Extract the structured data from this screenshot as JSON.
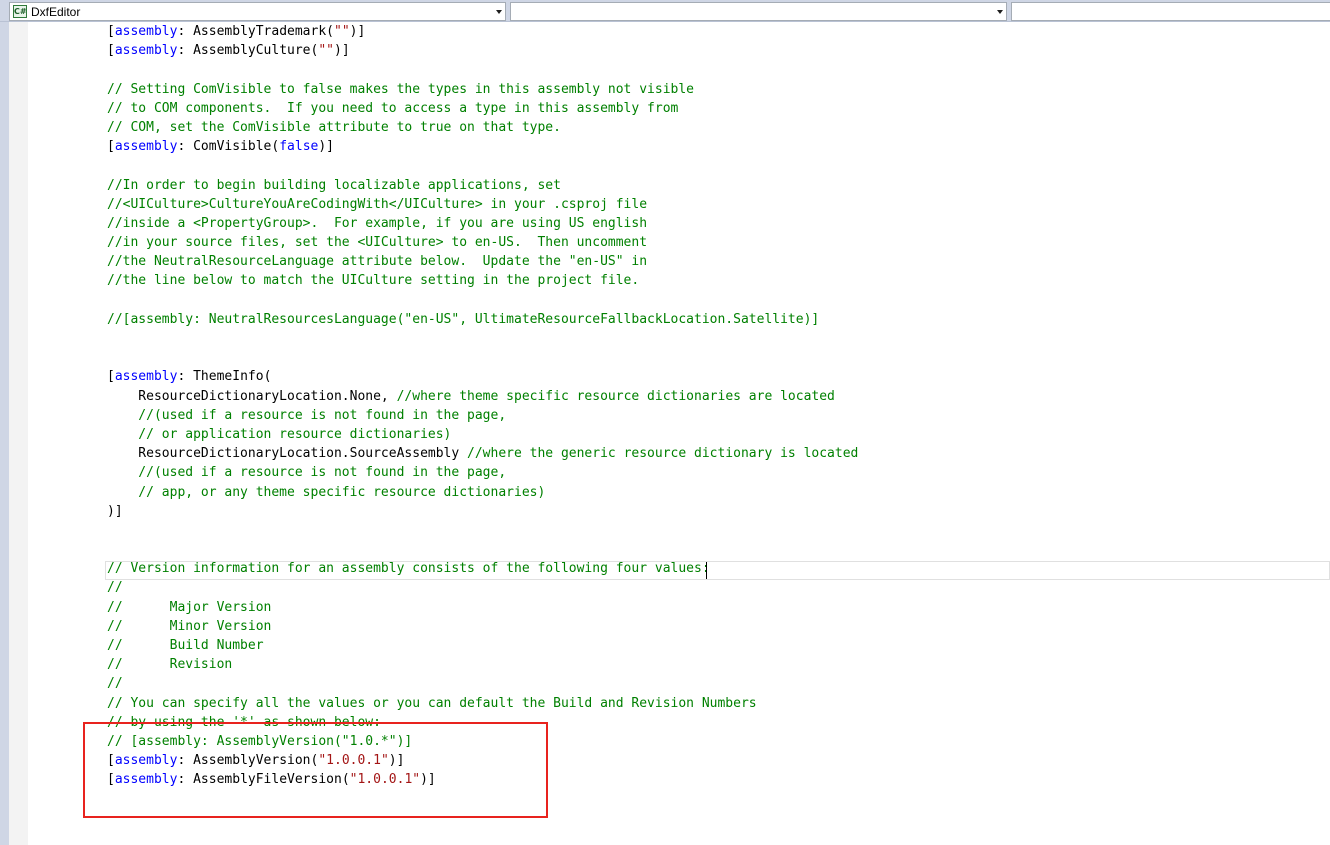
{
  "navbar": {
    "type_dropdown": {
      "icon": "csharp-file-icon",
      "icon_text": "C#",
      "value": "DxfEditor"
    },
    "member_dropdown": {
      "value": ""
    },
    "scope_dropdown": {
      "value": ""
    }
  },
  "colors": {
    "keyword": "#0000ff",
    "comment": "#008000",
    "string": "#a31515",
    "highlight_border": "#e8231e"
  },
  "editor": {
    "lines": [
      {
        "t": "attr",
        "name": "AssemblyTrademark",
        "arg": "\"\""
      },
      {
        "t": "attr",
        "name": "AssemblyCulture",
        "arg": "\"\""
      },
      {
        "t": "blank"
      },
      {
        "t": "comment",
        "text": "// Setting ComVisible to false makes the types in this assembly not visible"
      },
      {
        "t": "comment",
        "text": "// to COM components.  If you need to access a type in this assembly from"
      },
      {
        "t": "comment",
        "text": "// COM, set the ComVisible attribute to true on that type."
      },
      {
        "t": "attr_kw",
        "name": "ComVisible",
        "arg": "false"
      },
      {
        "t": "blank"
      },
      {
        "t": "comment",
        "text": "//In order to begin building localizable applications, set"
      },
      {
        "t": "comment",
        "text": "//<UICulture>CultureYouAreCodingWith</UICulture> in your .csproj file"
      },
      {
        "t": "comment",
        "text": "//inside a <PropertyGroup>.  For example, if you are using US english"
      },
      {
        "t": "comment",
        "text": "//in your source files, set the <UICulture> to en-US.  Then uncomment"
      },
      {
        "t": "comment",
        "text": "//the NeutralResourceLanguage attribute below.  Update the \"en-US\" in"
      },
      {
        "t": "comment",
        "text": "//the line below to match the UICulture setting in the project file."
      },
      {
        "t": "blank"
      },
      {
        "t": "comment",
        "text": "//[assembly: NeutralResourcesLanguage(\"en-US\", UltimateResourceFallbackLocation.Satellite)]"
      },
      {
        "t": "blank"
      },
      {
        "t": "blank"
      },
      {
        "t": "open",
        "name": "ThemeInfo"
      },
      {
        "t": "code_comment",
        "code": "    ResourceDictionaryLocation.None, ",
        "comment": "//where theme specific resource dictionaries are located"
      },
      {
        "t": "comment",
        "text": "    //(used if a resource is not found in the page,"
      },
      {
        "t": "comment",
        "text": "    // or application resource dictionaries)"
      },
      {
        "t": "code_comment",
        "code": "    ResourceDictionaryLocation.SourceAssembly ",
        "comment": "//where the generic resource dictionary is located"
      },
      {
        "t": "comment",
        "text": "    //(used if a resource is not found in the page,"
      },
      {
        "t": "comment",
        "text": "    // app, or any theme specific resource dictionaries)"
      },
      {
        "t": "plain",
        "text": ")]"
      },
      {
        "t": "blank"
      },
      {
        "t": "blank"
      },
      {
        "t": "comment",
        "text": "// Version information for an assembly consists of the following four values:"
      },
      {
        "t": "comment",
        "text": "//"
      },
      {
        "t": "comment",
        "text": "//      Major Version"
      },
      {
        "t": "comment",
        "text": "//      Minor Version"
      },
      {
        "t": "comment",
        "text": "//      Build Number"
      },
      {
        "t": "comment",
        "text": "//      Revision"
      },
      {
        "t": "comment",
        "text": "//"
      },
      {
        "t": "comment",
        "text": "// You can specify all the values or you can default the Build and Revision Numbers"
      },
      {
        "t": "comment",
        "text": "// by using the '*' as shown below:"
      },
      {
        "t": "comment",
        "text": "// [assembly: AssemblyVersion(\"1.0.*\")]"
      },
      {
        "t": "attr",
        "name": "AssemblyVersion",
        "arg": "\"1.0.0.1\""
      },
      {
        "t": "attr",
        "name": "AssemblyFileVersion",
        "arg": "\"1.0.0.1\""
      }
    ]
  }
}
